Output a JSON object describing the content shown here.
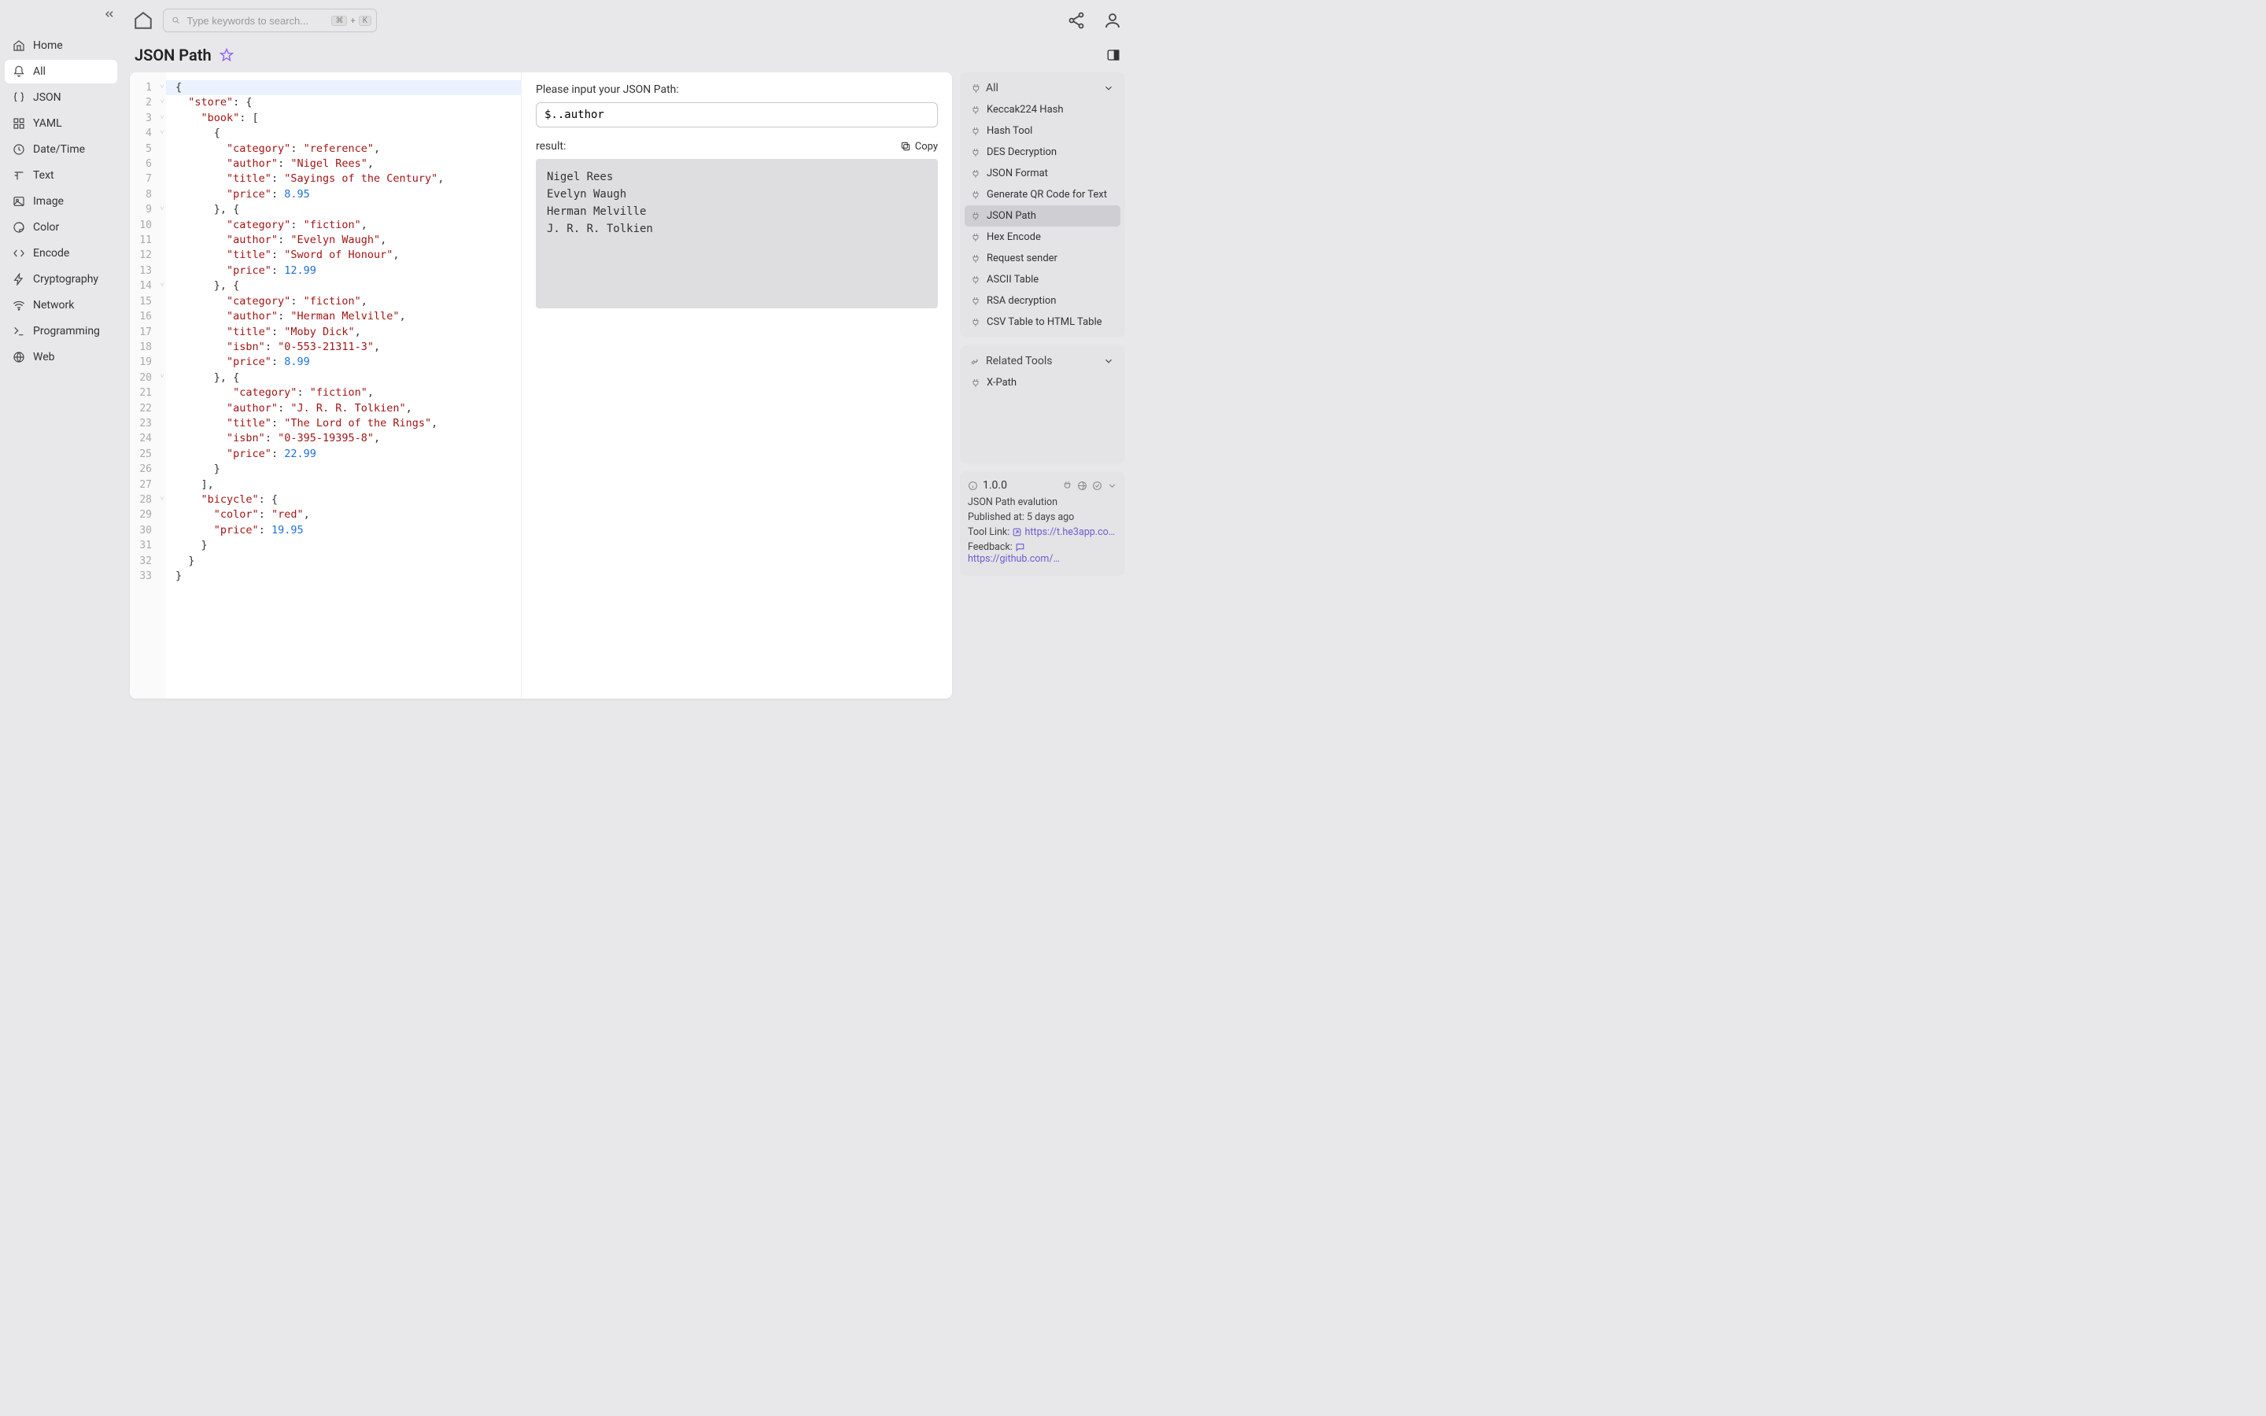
{
  "sidebar": {
    "items": [
      {
        "label": "Home"
      },
      {
        "label": "All"
      },
      {
        "label": "JSON"
      },
      {
        "label": "YAML"
      },
      {
        "label": "Date/Time"
      },
      {
        "label": "Text"
      },
      {
        "label": "Image"
      },
      {
        "label": "Color"
      },
      {
        "label": "Encode"
      },
      {
        "label": "Cryptography"
      },
      {
        "label": "Network"
      },
      {
        "label": "Programming"
      },
      {
        "label": "Web"
      }
    ],
    "active_index": 1
  },
  "search": {
    "placeholder": "Type keywords to search...",
    "shortcut_mod": "⌘",
    "shortcut_plus": "+",
    "shortcut_key": "K"
  },
  "page": {
    "title": "JSON Path"
  },
  "editor": {
    "lines": [
      "{",
      "  \"store\": {",
      "    \"book\": [",
      "      {",
      "        \"category\": \"reference\",",
      "        \"author\": \"Nigel Rees\",",
      "        \"title\": \"Sayings of the Century\",",
      "        \"price\": 8.95",
      "      }, {",
      "        \"category\": \"fiction\",",
      "        \"author\": \"Evelyn Waugh\",",
      "        \"title\": \"Sword of Honour\",",
      "        \"price\": 12.99",
      "      }, {",
      "        \"category\": \"fiction\",",
      "        \"author\": \"Herman Melville\",",
      "        \"title\": \"Moby Dick\",",
      "        \"isbn\": \"0-553-21311-3\",",
      "        \"price\": 8.99",
      "      }, {",
      "         \"category\": \"fiction\",",
      "        \"author\": \"J. R. R. Tolkien\",",
      "        \"title\": \"The Lord of the Rings\",",
      "        \"isbn\": \"0-395-19395-8\",",
      "        \"price\": 22.99",
      "      }",
      "    ],",
      "    \"bicycle\": {",
      "      \"color\": \"red\",",
      "      \"price\": 19.95",
      "    }",
      "  }",
      "}"
    ],
    "fold_lines": [
      1,
      2,
      3,
      4,
      9,
      14,
      20,
      28
    ]
  },
  "query": {
    "input_label": "Please input your JSON Path:",
    "value": "$..author",
    "result_label": "result:",
    "copy_label": "Copy",
    "results": [
      "Nigel Rees",
      "Evelyn Waugh",
      "Herman Melville",
      "J. R. R. Tolkien"
    ]
  },
  "rail": {
    "all_header": "All",
    "all_items": [
      "Keccak224 Hash",
      "Hash Tool",
      "DES Decryption",
      "JSON Format",
      "Generate QR Code for Text",
      "JSON Path",
      "Hex Encode",
      "Request sender",
      "ASCII Table",
      "RSA decryption",
      "CSV Table to HTML Table"
    ],
    "all_active_index": 5,
    "related_header": "Related Tools",
    "related_items": [
      "X-Path"
    ]
  },
  "version": {
    "version": "1.0.0",
    "description": "JSON Path evalution",
    "published_label": "Published at:",
    "published_value": "5 days ago",
    "tool_link_label": "Tool Link:",
    "tool_link_value": "https://t.he3app.co…",
    "feedback_label": "Feedback:",
    "feedback_value": "https://github.com/…"
  }
}
